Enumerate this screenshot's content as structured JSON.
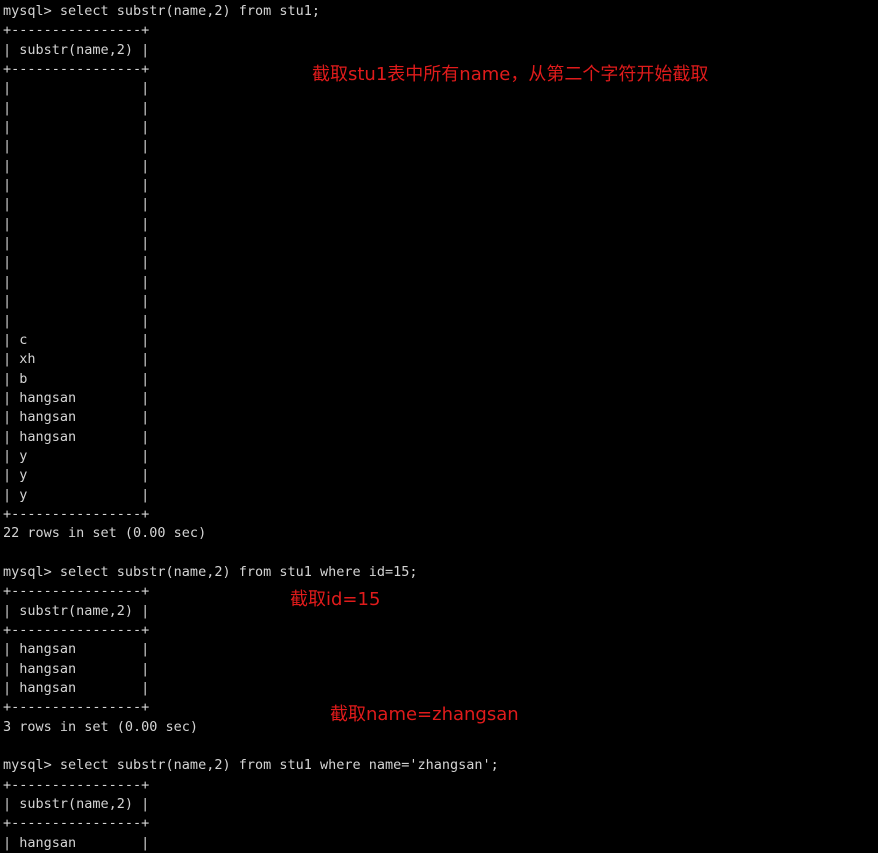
{
  "terminal": {
    "background_color": "#000000",
    "text_color": "#d4d4d4",
    "lines": [
      "mysql> select substr(name,2) from stu1;",
      "+----------------+",
      "| substr(name,2) |",
      "+----------------+",
      "|                |",
      "|                |",
      "|                |",
      "|                |",
      "|                |",
      "|                |",
      "|                |",
      "|                |",
      "|                |",
      "|                |",
      "|                |",
      "|                |",
      "|                |",
      "| c              |",
      "| xh             |",
      "| b              |",
      "| hangsan        |",
      "| hangsan        |",
      "| hangsan        |",
      "| y              |",
      "| y              |",
      "| y              |",
      "+----------------+",
      "22 rows in set (0.00 sec)",
      "",
      "mysql> select substr(name,2) from stu1 where id=15;",
      "+----------------+",
      "| substr(name,2) |",
      "+----------------+",
      "| hangsan        |",
      "| hangsan        |",
      "| hangsan        |",
      "+----------------+",
      "3 rows in set (0.00 sec)",
      "",
      "mysql> select substr(name,2) from stu1 where name='zhangsan';",
      "+----------------+",
      "| substr(name,2) |",
      "+----------------+",
      "| hangsan        |"
    ]
  },
  "annotations": {
    "color": "#e01b1b",
    "items": [
      {
        "text": "截取stu1表中所有name，从第二个字符开始截取"
      },
      {
        "text": "截取id=15"
      },
      {
        "text": "截取name=zhangsan"
      }
    ]
  },
  "queries": [
    {
      "prompt": "mysql>",
      "sql": "select substr(name,2) from stu1;",
      "column_header": "substr(name,2)",
      "result_rows": [
        "",
        "",
        "",
        "",
        "",
        "",
        "",
        "",
        "",
        "",
        "",
        "",
        "",
        "c",
        "xh",
        "b",
        "hangsan",
        "hangsan",
        "hangsan",
        "y",
        "y",
        "y"
      ],
      "status": "22 rows in set (0.00 sec)"
    },
    {
      "prompt": "mysql>",
      "sql": "select substr(name,2) from stu1 where id=15;",
      "column_header": "substr(name,2)",
      "result_rows": [
        "hangsan",
        "hangsan",
        "hangsan"
      ],
      "status": "3 rows in set (0.00 sec)"
    },
    {
      "prompt": "mysql>",
      "sql": "select substr(name,2) from stu1 where name='zhangsan';",
      "column_header": "substr(name,2)",
      "result_rows": [
        "hangsan"
      ],
      "status": ""
    }
  ]
}
